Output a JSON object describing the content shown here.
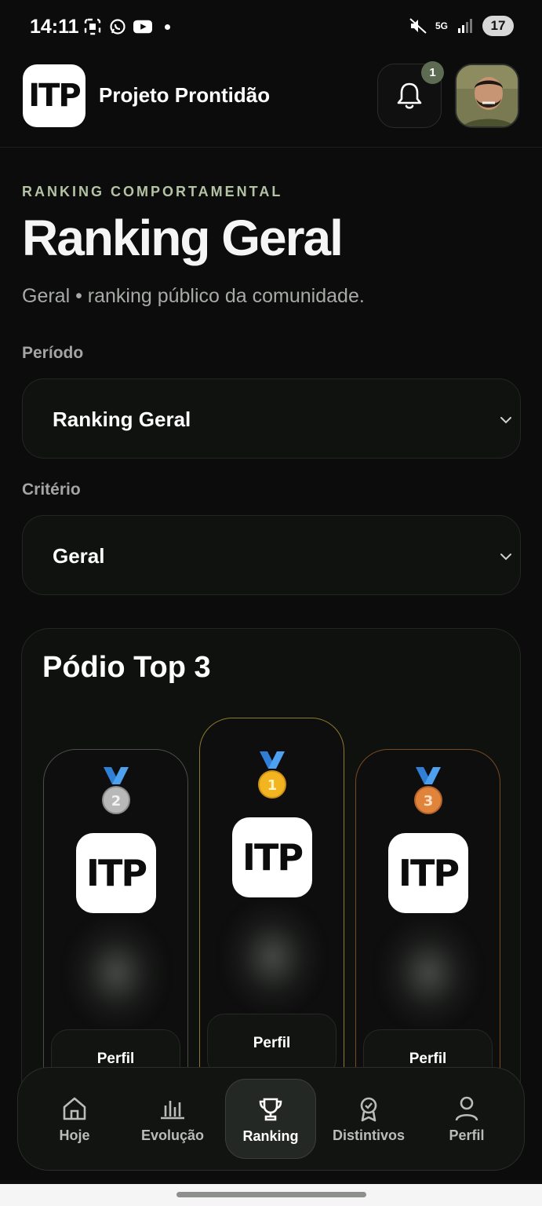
{
  "status_bar": {
    "time": "14:11",
    "network": "5G",
    "battery": "17"
  },
  "header": {
    "logo_text": "ITP",
    "app_title": "Projeto Prontidão",
    "notification_count": "1"
  },
  "page": {
    "eyebrow": "RANKING COMPORTAMENTAL",
    "title": "Ranking Geral",
    "subtitle": "Geral • ranking público da comunidade."
  },
  "filters": {
    "period_label": "Período",
    "period_value": "Ranking Geral",
    "criterion_label": "Critério",
    "criterion_value": "Geral"
  },
  "podium": {
    "title": "Pódio Top 3",
    "entries": [
      {
        "place": "2",
        "logo_text": "ITP",
        "button": "Perfil",
        "accent": "#4a4d4a",
        "medal_color": "#b8b8b8"
      },
      {
        "place": "1",
        "logo_text": "ITP",
        "button": "Perfil",
        "accent": "#8f7a2c",
        "medal_color": "#f2b521"
      },
      {
        "place": "3",
        "logo_text": "ITP",
        "button": "Perfil",
        "accent": "#7a4a22",
        "medal_color": "#e0843c"
      }
    ]
  },
  "nav": {
    "items": [
      {
        "label": "Hoje",
        "icon": "home-icon"
      },
      {
        "label": "Evolução",
        "icon": "chart-icon"
      },
      {
        "label": "Ranking",
        "icon": "trophy-icon",
        "active": true
      },
      {
        "label": "Distintivos",
        "icon": "badge-icon"
      },
      {
        "label": "Perfil",
        "icon": "user-icon"
      }
    ]
  }
}
